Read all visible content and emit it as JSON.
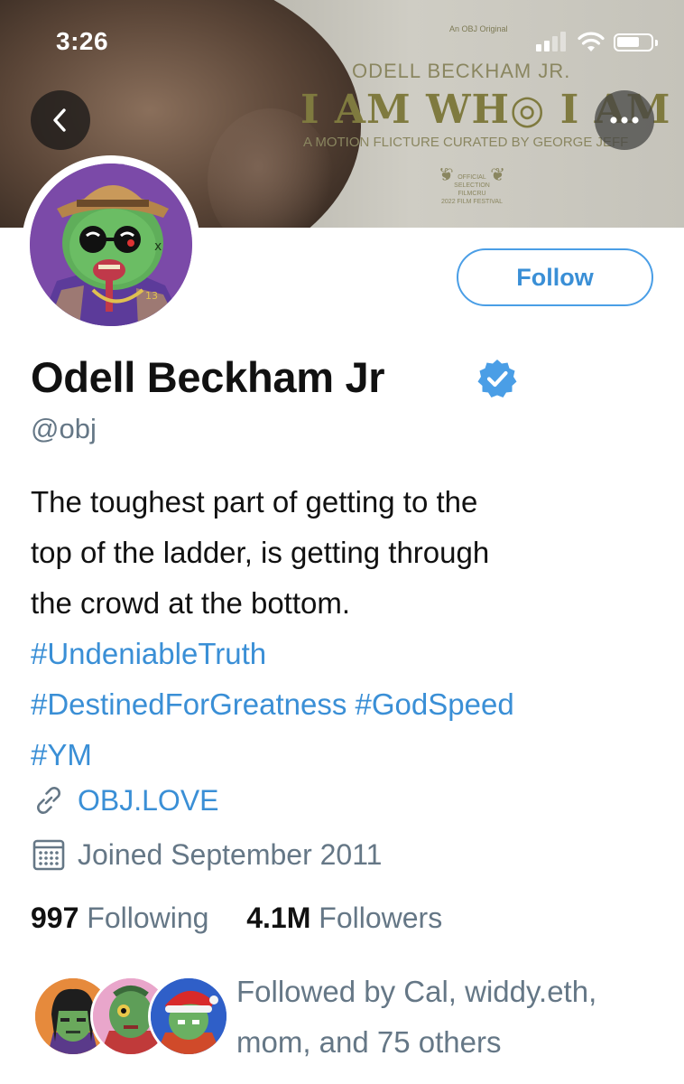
{
  "status_bar": {
    "time": "3:26"
  },
  "banner": {
    "small_text": "An OBJ Original",
    "subtitle": "ODELL BECKHAM JR.",
    "title": "I AM WH◎ I AM",
    "tagline": "A MOTION FLICTURE CURATED BY GEORGE JEFF",
    "laurel_text": "OFFICIAL SELECTION\nFILMCRU\n2022 FILM FESTIVAL"
  },
  "nav": {
    "back_icon": "chevron-left-icon",
    "more_icon": "ellipsis-icon"
  },
  "profile": {
    "follow_label": "Follow",
    "display_name": "Odell Beckham Jr",
    "handle": "@obj",
    "bio_lines": [
      "The toughest part of getting to the",
      "top of the ladder, is getting through",
      "the crowd at the bottom."
    ],
    "hashtags": [
      "#UndeniableTruth",
      "#DestinedForGreatness",
      "#GodSpeed",
      "#YM"
    ],
    "website": "OBJ.LOVE",
    "joined": "Joined September 2011",
    "following_count": "997",
    "following_label": "Following",
    "followers_count": "4.1M",
    "followers_label": "Followers",
    "followed_by_line1": "Followed by Cal, widdy.eth,",
    "followed_by_line2": "mom, and 75 others"
  },
  "colors": {
    "accent": "#3a8fd6",
    "secondary_text": "#657786",
    "verified": "#1d9bf0"
  }
}
